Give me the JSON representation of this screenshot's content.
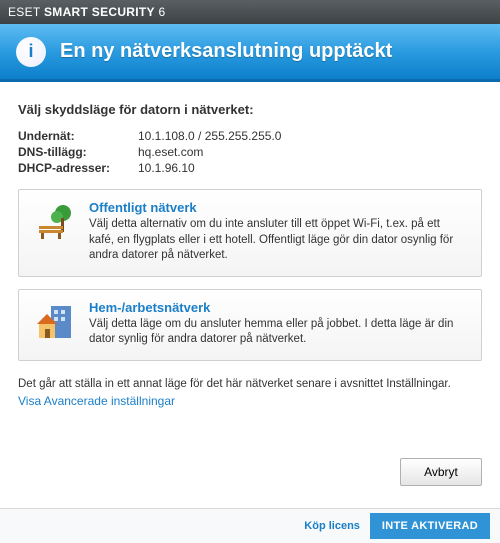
{
  "titlebar": {
    "brand_thin": "ESET ",
    "brand_bold": "SMART SECURITY",
    "version": " 6"
  },
  "banner": {
    "icon_glyph": "i",
    "title": "En ny nätverksanslutning upptäckt"
  },
  "heading": "Välj skyddsläge för datorn i nätverket:",
  "network": {
    "subnet_label": "Undernät:",
    "subnet_value": "10.1.108.0 / 255.255.255.0",
    "dns_label": "DNS-tillägg:",
    "dns_value": "hq.eset.com",
    "dhcp_label": "DHCP-adresser:",
    "dhcp_value": "10.1.96.10"
  },
  "options": {
    "public": {
      "title": "Offentligt nätverk",
      "desc": "Välj detta alternativ om du inte ansluter till ett öppet Wi-Fi, t.ex. på ett kafé, en flygplats eller i ett hotell. Offentligt läge gör din dator osynlig för andra datorer på nätverket."
    },
    "home": {
      "title": "Hem-/arbetsnätverk",
      "desc": "Välj detta läge om du ansluter hemma eller på jobbet. I detta läge är din dator synlig för andra datorer på nätverket."
    }
  },
  "note": "Det går att ställa in ett annat läge för det här nätverket senare i avsnittet Inställningar.",
  "advanced_link": "Visa Avancerade inställningar",
  "cancel_label": "Avbryt",
  "footer": {
    "buy_label": "Köp licens",
    "status_label": "INTE AKTIVERAD"
  }
}
